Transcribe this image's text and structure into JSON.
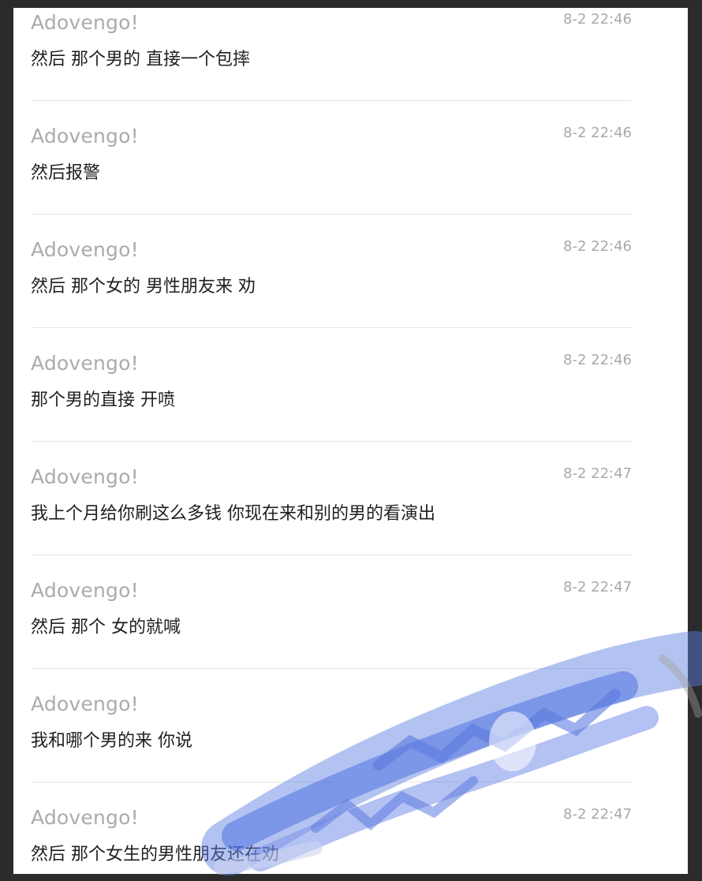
{
  "messages": [
    {
      "sender": "Adovengo!",
      "time": "8-2 22:46",
      "text": "然后 那个男的 直接一个包摔"
    },
    {
      "sender": "Adovengo!",
      "time": "8-2 22:46",
      "text": "然后报警"
    },
    {
      "sender": "Adovengo!",
      "time": "8-2 22:46",
      "text": "然后 那个女的 男性朋友来 劝"
    },
    {
      "sender": "Adovengo!",
      "time": "8-2 22:46",
      "text": "那个男的直接 开喷"
    },
    {
      "sender": "Adovengo!",
      "time": "8-2 22:47",
      "text": "我上个月给你刷这么多钱 你现在来和别的男的看演出"
    },
    {
      "sender": "Adovengo!",
      "time": "8-2 22:47",
      "text": "然后 那个 女的就喊"
    },
    {
      "sender": "Adovengo!",
      "time": "",
      "text": "我和哪个男的来 你说"
    },
    {
      "sender": "Adovengo!",
      "time": "8-2 22:47",
      "text": "然后 那个女生的男性朋友还在劝"
    }
  ],
  "colors": {
    "sender": "#ababab",
    "time": "#a9a9a9",
    "text": "#1f1f1f",
    "divider": "#e4e4e4",
    "redaction": "#5c7de0"
  }
}
